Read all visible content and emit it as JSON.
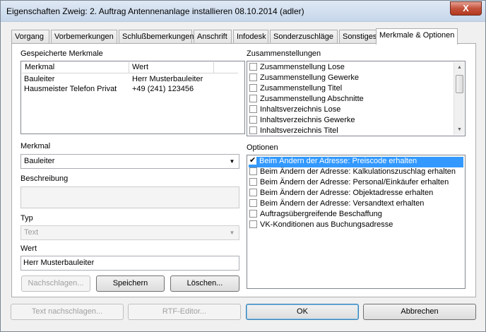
{
  "window": {
    "title": "Eigenschaften Zweig: 2. Auftrag Antennenanlage installieren 08.10.2014 (adler)",
    "close_glyph": "X"
  },
  "tabs": [
    {
      "label": "Vorgang"
    },
    {
      "label": "Vorbemerkungen"
    },
    {
      "label": "Schlußbemerkungen"
    },
    {
      "label": "Anschrift"
    },
    {
      "label": "Infodesk"
    },
    {
      "label": "Sonderzuschläge"
    },
    {
      "label": "Sonstiges"
    },
    {
      "label": "Merkmale & Optionen"
    }
  ],
  "active_tab": "Merkmale & Optionen",
  "saved_features": {
    "label": "Gespeicherte Merkmale",
    "columns": [
      "Merkmal",
      "Wert"
    ],
    "rows": [
      {
        "merkmal": "Bauleiter",
        "wert": "Herr Musterbauleiter"
      },
      {
        "merkmal": "Hausmeister Telefon Privat",
        "wert": "+49 (241) 123456"
      }
    ]
  },
  "feature": {
    "label": "Merkmal",
    "value": "Bauleiter"
  },
  "description": {
    "label": "Beschreibung",
    "value": ""
  },
  "type": {
    "label": "Typ",
    "value": "Text"
  },
  "value_field": {
    "label": "Wert",
    "value": "Herr Musterbauleiter"
  },
  "left_buttons": {
    "lookup": "Nachschlagen...",
    "save": "Speichern",
    "delete": "Löschen..."
  },
  "compilations": {
    "label": "Zusammenstellungen",
    "items": [
      {
        "label": "Zusammenstellung Lose",
        "checked": false
      },
      {
        "label": "Zusammenstellung Gewerke",
        "checked": false
      },
      {
        "label": "Zusammenstellung Titel",
        "checked": false
      },
      {
        "label": "Zusammenstellung Abschnitte",
        "checked": false
      },
      {
        "label": "Inhaltsverzeichnis Lose",
        "checked": false
      },
      {
        "label": "Inhaltsverzeichnis Gewerke",
        "checked": false
      },
      {
        "label": "Inhaltsverzeichnis Titel",
        "checked": false
      }
    ]
  },
  "options": {
    "label": "Optionen",
    "items": [
      {
        "label": "Beim Ändern der Adresse: Preiscode erhalten",
        "checked": true,
        "selected": true
      },
      {
        "label": "Beim Ändern der Adresse: Kalkulationszuschlag erhalten",
        "checked": false
      },
      {
        "label": "Beim Ändern der Adresse: Personal/Einkäufer erhalten",
        "checked": false
      },
      {
        "label": "Beim Ändern der Adresse: Objektadresse erhalten",
        "checked": false
      },
      {
        "label": "Beim Ändern der Adresse: Versandtext erhalten",
        "checked": false
      },
      {
        "label": "Auftragsübergreifende Beschaffung",
        "checked": false
      },
      {
        "label": "VK-Konditionen aus Buchungsadresse",
        "checked": false
      }
    ]
  },
  "footer": {
    "text_lookup": "Text nachschlagen...",
    "rtf_editor": "RTF-Editor...",
    "ok": "OK",
    "cancel": "Abbrechen"
  },
  "icons": {
    "dropdown": "▼",
    "scroll_up": "▲",
    "scroll_down": "▼"
  }
}
